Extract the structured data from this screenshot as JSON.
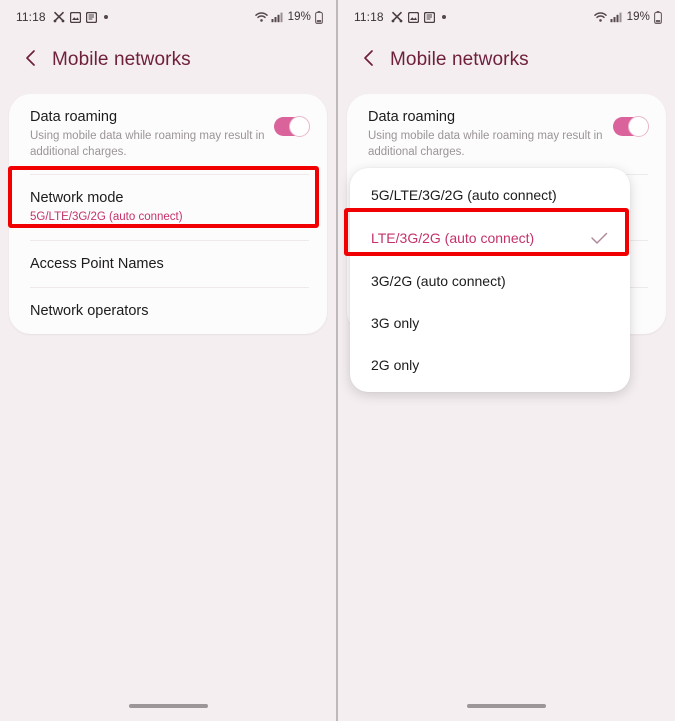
{
  "status_bar": {
    "time": "11:18",
    "left_icons": [
      "scissors-icon",
      "image-icon",
      "document-icon",
      "dot-icon"
    ],
    "right_icons": [
      "wifi-icon",
      "cellular-signal-icon"
    ],
    "battery_percent": "19%",
    "battery_icon": "battery-icon"
  },
  "app_bar": {
    "back_icon": "back-chevron-icon",
    "title": "Mobile networks"
  },
  "settings": {
    "data_roaming": {
      "title": "Data roaming",
      "subtitle": "Using mobile data while roaming may result in additional charges.",
      "toggle_state": "on"
    },
    "network_mode": {
      "title": "Network mode",
      "subtitle": "5G/LTE/3G/2G (auto connect)"
    },
    "access_point_names": {
      "title": "Access Point Names"
    },
    "network_operators": {
      "title": "Network operators"
    }
  },
  "dropdown": {
    "options": [
      {
        "label": "5G/LTE/3G/2G (auto connect)",
        "selected": false
      },
      {
        "label": "LTE/3G/2G (auto connect)",
        "selected": true
      },
      {
        "label": "3G/2G (auto connect)",
        "selected": false
      },
      {
        "label": "3G only",
        "selected": false
      },
      {
        "label": "2G only",
        "selected": false
      }
    ],
    "check_icon": "check-icon"
  },
  "annotations": {
    "highlight_color": "#f00000",
    "left_panel_target": "Network mode",
    "right_panel_target": "LTE/3G/2G (auto connect)"
  },
  "colors": {
    "background": "#f4eef0",
    "card": "#fdfcfc",
    "title_accent": "#6e1f3c",
    "pink_accent": "#c4326a",
    "toggle_on": "#d9639a"
  },
  "gesture_bar": "home-gesture-bar"
}
